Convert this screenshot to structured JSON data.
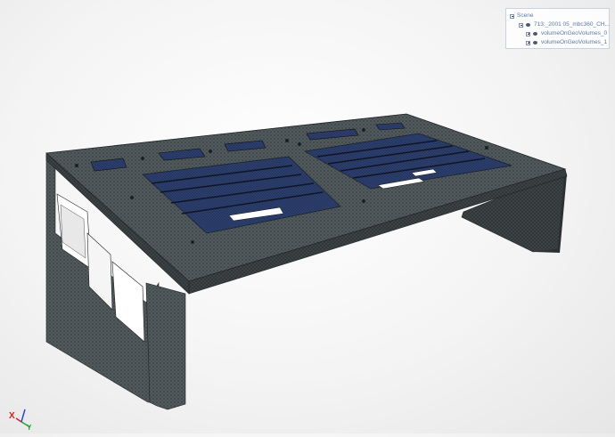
{
  "scene_tree": {
    "root_label": "Scene",
    "items": [
      {
        "label": "713:_2001 05_mbc360_CH...",
        "indent": 1,
        "toggle": "minus"
      },
      {
        "label": "volumeOnGeoVolumes_0",
        "indent": 2,
        "toggle": "plus"
      },
      {
        "label": "volumeOnGeoVolumes_1",
        "indent": 2,
        "toggle": "plus"
      }
    ]
  },
  "axes": {
    "x_label": "X",
    "y_label": "Y",
    "x_color": "#d02020",
    "y_color": "#20a030",
    "z_color": "#2040d0"
  },
  "colors": {
    "mesh_gray": "#4a5254",
    "mesh_dark": "#2f3537",
    "panel_blue": "#2a3d6a",
    "panel_blue_light": "#3a5088"
  },
  "icons": [
    "minus-toggle-icon",
    "plus-toggle-icon",
    "eye-icon",
    "axes-gizmo-icon"
  ]
}
